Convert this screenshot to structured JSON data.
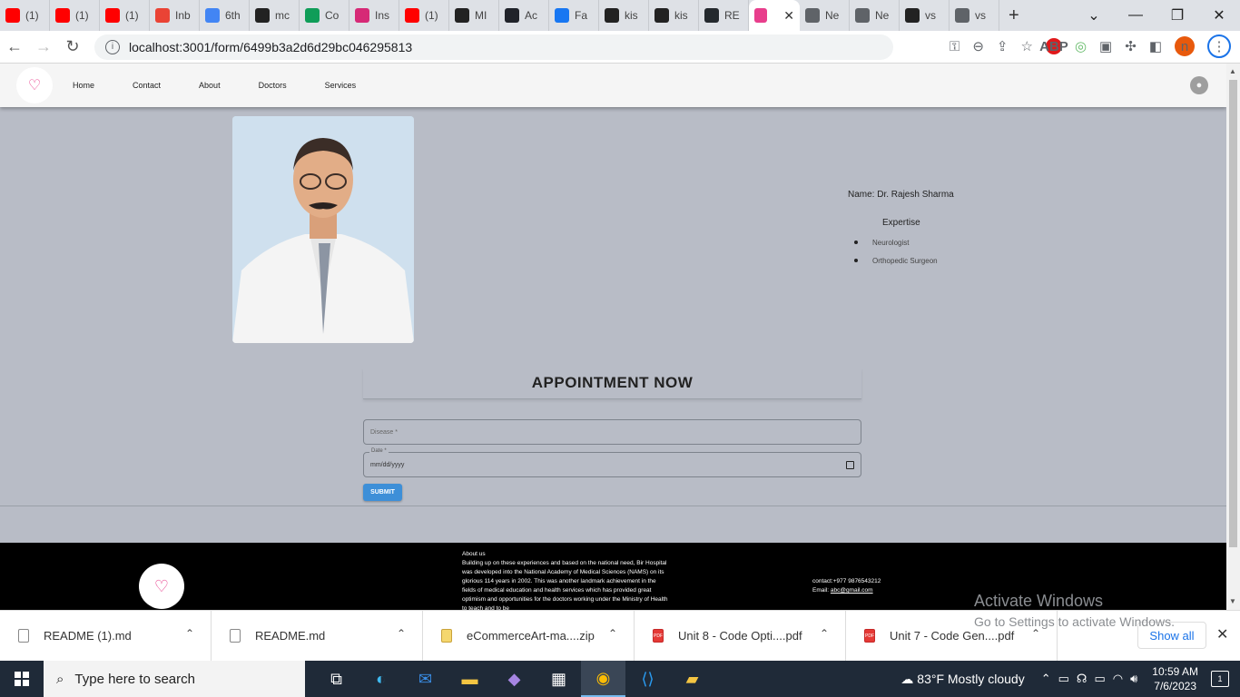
{
  "browser": {
    "tabs": [
      {
        "label": "(1)",
        "icon": "youtube-icon",
        "color": "#ff0000"
      },
      {
        "label": "(1)",
        "icon": "youtube-icon",
        "color": "#ff0000"
      },
      {
        "label": "(1)",
        "icon": "youtube-icon",
        "color": "#ff0000"
      },
      {
        "label": "Inb",
        "icon": "gmail-icon",
        "color": "#ea4335"
      },
      {
        "label": "6th",
        "icon": "google-icon",
        "color": "#4285f4"
      },
      {
        "label": "mc",
        "icon": "github-icon",
        "color": "#222222"
      },
      {
        "label": "Co",
        "icon": "drive-icon",
        "color": "#0f9d58"
      },
      {
        "label": "Ins",
        "icon": "instagram-icon",
        "color": "#d62976"
      },
      {
        "label": "(1)",
        "icon": "youtube-icon",
        "color": "#ff0000"
      },
      {
        "label": "MI",
        "icon": "github-icon",
        "color": "#222222"
      },
      {
        "label": "Ac",
        "icon": "react-icon",
        "color": "#20232a"
      },
      {
        "label": "Fa",
        "icon": "facebook-icon",
        "color": "#1877f2"
      },
      {
        "label": "kis",
        "icon": "github-icon",
        "color": "#222222"
      },
      {
        "label": "kis",
        "icon": "github-icon",
        "color": "#222222"
      },
      {
        "label": "RE",
        "icon": "github-cat-icon",
        "color": "#24292e"
      },
      {
        "label": "",
        "icon": "app-favicon-icon",
        "color": "#e83e8c",
        "active": true
      },
      {
        "label": "Ne",
        "icon": "globe-icon",
        "color": "#5f6368"
      },
      {
        "label": "Ne",
        "icon": "globe-icon",
        "color": "#5f6368"
      },
      {
        "label": "vs",
        "icon": "github-icon",
        "color": "#222222"
      },
      {
        "label": "vs",
        "icon": "globe-icon",
        "color": "#5f6368"
      }
    ],
    "url": "localhost:3001/form/6499b3a2d6d29bc046295813",
    "profile_initial": "n"
  },
  "app": {
    "nav": [
      "Home",
      "Contact",
      "About",
      "Doctors",
      "Services"
    ],
    "doctor_name": "Name: Dr. Rajesh Sharma",
    "expertise_title": "Expertise",
    "expertise": [
      "Neurologist",
      "Orthopedic Surgeon"
    ],
    "appointment_title": "APPOINTMENT NOW",
    "disease_placeholder": "Disease *",
    "date_label": "Date *",
    "date_placeholder": "mm/dd/yyyy",
    "submit_label": "SUBMIT"
  },
  "footer": {
    "about_title": "About us",
    "about_text": "Building up on these experiences and based on the national need, Bir Hospital was developed into the National Academy of Medical Sciences (NAMS) on its glorious 114 years in 2002. This was another landmark achievement in the fields of medical education and health services which has provided great optimism and opportunities for the doctors working under the Ministry of Health to teach and to be",
    "contact": "contact:+977 9876543212",
    "email_label": "Email: ",
    "email": "abc@gmail.com"
  },
  "watermark": {
    "line1": "Activate Windows",
    "line2": "Go to Settings to activate Windows."
  },
  "downloads": {
    "items": [
      {
        "name": "README (1).md",
        "type": "md"
      },
      {
        "name": "README.md",
        "type": "md"
      },
      {
        "name": "eCommerceArt-ma....zip",
        "type": "zip"
      },
      {
        "name": "Unit 8 - Code Opti....pdf",
        "type": "pdf"
      },
      {
        "name": "Unit 7 - Code Gen....pdf",
        "type": "pdf"
      }
    ],
    "show_all": "Show all"
  },
  "taskbar": {
    "search_placeholder": "Type here to search",
    "weather": "83°F  Mostly cloudy",
    "time": "10:59 AM",
    "date": "7/6/2023",
    "notifications": "1"
  }
}
